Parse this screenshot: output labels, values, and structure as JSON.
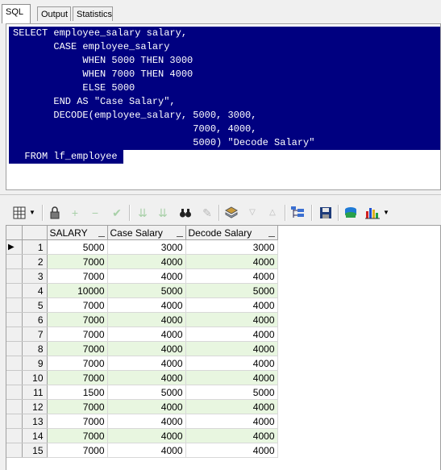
{
  "tabs": [
    "SQL",
    "Output",
    "Statistics"
  ],
  "sql_lines": [
    "SELECT employee_salary salary,",
    "       CASE employee_salary",
    "            WHEN 5000 THEN 3000",
    "            WHEN 7000 THEN 4000",
    "            ELSE 5000",
    "       END AS \"Case Salary\",",
    "       DECODE(employee_salary, 5000, 3000,",
    "                               7000, 4000,",
    "                               5000) \"Decode Salary\"",
    "  FROM lf_employee"
  ],
  "toolbar_icons": [
    "grid-view-icon",
    "dropdown-arrow-icon",
    "lock-icon",
    "add-record-icon",
    "delete-record-icon",
    "post-check-icon",
    "filter-down-icon",
    "filter-up-icon",
    "find-binoculars-icon",
    "clear-icon",
    "stacks-icon",
    "sort-down-icon",
    "sort-up-icon",
    "tree-icon",
    "save-disk-icon",
    "export-icon",
    "chart-icon",
    "chart-dropdown-icon"
  ],
  "grid": {
    "columns": [
      "SALARY",
      "Case Salary",
      "Decode Salary"
    ],
    "current_row_marker": "▶",
    "rows": [
      {
        "n": "1",
        "salary": "5000",
        "case": "3000",
        "decode": "3000"
      },
      {
        "n": "2",
        "salary": "7000",
        "case": "4000",
        "decode": "4000"
      },
      {
        "n": "3",
        "salary": "7000",
        "case": "4000",
        "decode": "4000"
      },
      {
        "n": "4",
        "salary": "10000",
        "case": "5000",
        "decode": "5000"
      },
      {
        "n": "5",
        "salary": "7000",
        "case": "4000",
        "decode": "4000"
      },
      {
        "n": "6",
        "salary": "7000",
        "case": "4000",
        "decode": "4000"
      },
      {
        "n": "7",
        "salary": "7000",
        "case": "4000",
        "decode": "4000"
      },
      {
        "n": "8",
        "salary": "7000",
        "case": "4000",
        "decode": "4000"
      },
      {
        "n": "9",
        "salary": "7000",
        "case": "4000",
        "decode": "4000"
      },
      {
        "n": "10",
        "salary": "7000",
        "case": "4000",
        "decode": "4000"
      },
      {
        "n": "11",
        "salary": "1500",
        "case": "5000",
        "decode": "5000"
      },
      {
        "n": "12",
        "salary": "7000",
        "case": "4000",
        "decode": "4000"
      },
      {
        "n": "13",
        "salary": "7000",
        "case": "4000",
        "decode": "4000"
      },
      {
        "n": "14",
        "salary": "7000",
        "case": "4000",
        "decode": "4000"
      },
      {
        "n": "15",
        "salary": "7000",
        "case": "4000",
        "decode": "4000"
      }
    ]
  },
  "colors": {
    "selection": "#000080",
    "alt_row": "#e8f6e0"
  }
}
